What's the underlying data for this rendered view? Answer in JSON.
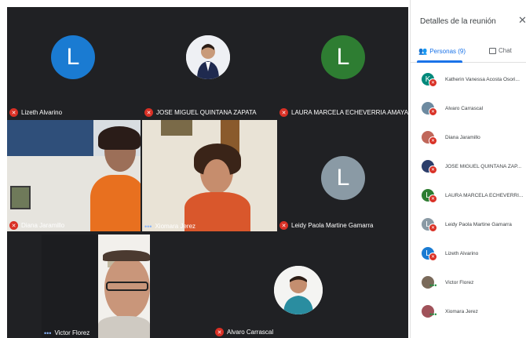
{
  "tiles": [
    {
      "name": "Lizeth Alvarino",
      "kind": "avatar",
      "letter": "L",
      "color": "#1a7bd2",
      "mic": "off"
    },
    {
      "name": "JOSE MIGUEL QUINTANA ZAPATA",
      "kind": "photo",
      "mic": "off"
    },
    {
      "name": "LAURA MARCELA ECHEVERRIA AMAYA",
      "kind": "avatar",
      "letter": "L",
      "color": "#2e7d32",
      "mic": "off"
    },
    {
      "name": "Diana Jaramillo",
      "kind": "video",
      "mic": "off"
    },
    {
      "name": "Xiomara Jerez",
      "kind": "video",
      "mic": "speaking"
    },
    {
      "name": "Leidy Paola Martine Gamarra",
      "kind": "avatar",
      "letter": "L",
      "color": "#8a9aa5",
      "mic": "off"
    },
    {
      "name": "Victor Florez",
      "kind": "video",
      "mic": "speaking"
    },
    {
      "name": "Alvaro Carrascal",
      "kind": "photo",
      "mic": "off"
    }
  ],
  "panel": {
    "title": "Detalles de la reunión",
    "close_icon": "close-icon",
    "tab_people": "Personas (9)",
    "tab_chat": "Chat"
  },
  "participants": [
    {
      "name": "Katherin Vanessa Acosta Osori...",
      "letter": "K",
      "color": "#00897b",
      "status": "muted"
    },
    {
      "name": "Alvaro Carrascal",
      "letter": "",
      "color": "#6d8aa0",
      "status": "muted"
    },
    {
      "name": "Diana Jaramillo",
      "letter": "",
      "color": "#c0675a",
      "status": "muted"
    },
    {
      "name": "JOSE MIGUEL QUINTANA ZAP...",
      "letter": "",
      "color": "#2c3e6b",
      "status": "muted"
    },
    {
      "name": "LAURA MARCELA ECHEVERRI...",
      "letter": "L",
      "color": "#2e7d32",
      "status": "muted"
    },
    {
      "name": "Leidy Paola Martine Gamarra",
      "letter": "L",
      "color": "#8a9aa5",
      "status": "muted"
    },
    {
      "name": "Lizeth Alvarino",
      "letter": "L",
      "color": "#1a7bd2",
      "status": "muted"
    },
    {
      "name": "Victor Florez",
      "letter": "",
      "color": "#7a6a5a",
      "status": "speaking"
    },
    {
      "name": "Xiomara Jerez",
      "letter": "",
      "color": "#a0525a",
      "status": "speaking"
    }
  ],
  "colors": {
    "accent": "#1a73e8",
    "muted": "#d93025",
    "speaking": "#8ab4f8"
  }
}
